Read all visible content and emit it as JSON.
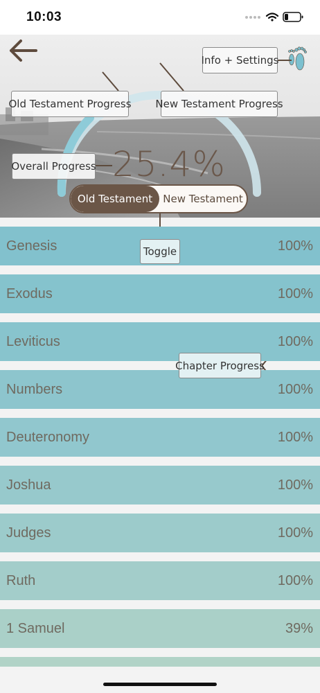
{
  "status": {
    "time": "10:03"
  },
  "annotations": {
    "info_settings": "Info + Settings",
    "old_testament_progress": "Old Testament Progress",
    "new_testament_progress": "New Testament Progress",
    "overall_progress": "Overall Progress",
    "toggle": "Toggle",
    "chapter_progress": "Chapter Progress"
  },
  "progress": {
    "overall_label": "25.4%",
    "overall_fraction": 0.254
  },
  "toggle": {
    "options": [
      "Old Testament",
      "New Testament"
    ],
    "selected": "Old Testament"
  },
  "books": [
    {
      "name": "Genesis",
      "percent": "100%",
      "color": "#82c1cd"
    },
    {
      "name": "Exodus",
      "percent": "100%",
      "color": "#85c3cd"
    },
    {
      "name": "Leviticus",
      "percent": "100%",
      "color": "#88c4cd"
    },
    {
      "name": "Numbers",
      "percent": "100%",
      "color": "#8dc5cd"
    },
    {
      "name": "Deuteronomy",
      "percent": "100%",
      "color": "#91c7ce"
    },
    {
      "name": "Joshua",
      "percent": "100%",
      "color": "#97c9cc"
    },
    {
      "name": "Judges",
      "percent": "100%",
      "color": "#9ccbcb"
    },
    {
      "name": "Ruth",
      "percent": "100%",
      "color": "#a3cdca"
    },
    {
      "name": "1 Samuel",
      "percent": "39%",
      "color": "#aad0c8"
    },
    {
      "name": "",
      "percent": "",
      "color": "#b1d3c7"
    }
  ],
  "colors": {
    "accent_brown": "#6b5647",
    "arc_teal": "#8ecbd8",
    "arc_light": "#cfe6ec"
  }
}
